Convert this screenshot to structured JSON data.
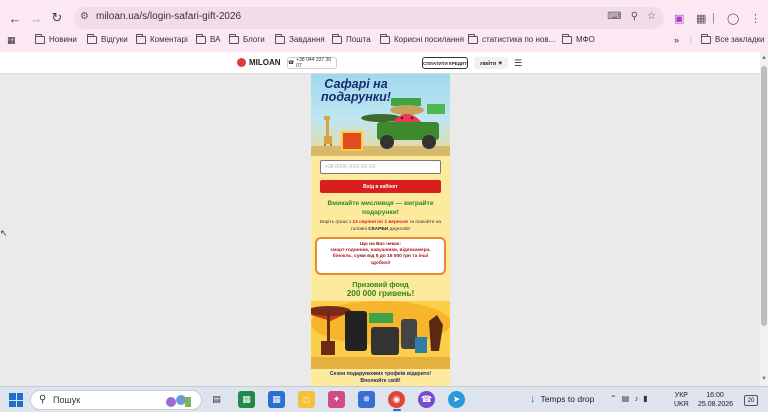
{
  "browser": {
    "url": "miloan.ua/s/login-safari-gift-2026",
    "bookmarks": [
      {
        "label": "Новини"
      },
      {
        "label": "Відгуки"
      },
      {
        "label": "Коментарі"
      },
      {
        "label": "ВА"
      },
      {
        "label": "Блоги"
      },
      {
        "label": "Завдання"
      },
      {
        "label": "Пошта"
      },
      {
        "label": "Корисні посилання"
      },
      {
        "label": "статистика по нов..."
      },
      {
        "label": "МФО"
      }
    ],
    "all_bookmarks": "Все закладки"
  },
  "site": {
    "logo": "MILOAN",
    "phone": "+38 044 337 30 07",
    "pay_credit": "СПЛАТИТИ КРЕДИТ",
    "login": "УВІЙТИ"
  },
  "promo": {
    "title": "Сафарі на подарунки!",
    "phone_placeholder": "+38 (0XX) XXX-XX-XX",
    "cabinet_button": "Вхід в кабінет",
    "headline": "Вмикайте мисливця — виграйте подарунки!",
    "rules_1": "Беріть гроші з ",
    "rules_dates": "13 серпня по 1 вересня",
    "rules_2": " та полюйте на головні ",
    "rules_bold": "СКАРБИ",
    "rules_3": " джунглів!",
    "prize_line_1": "Що на Вас чекає:",
    "prize_line_2": "смарт-годинник, навушники, відеокамера,",
    "prize_line_3": "бінокль, ",
    "prize_line_3_dark": "суми від 5 до 15 000 грн",
    "prize_line_3_end": " та інші",
    "prize_line_4": "здобичі!",
    "fund_label": "Призовий фонд",
    "fund_value": "200 000 гривень!",
    "season_1": "Сезон подарункових трофеїв відкрито!",
    "season_2": "Вполюйте свій!"
  },
  "taskbar": {
    "search": "Пошук",
    "weather": "Temps to drop",
    "lang_1": "УКР",
    "lang_2": "UKR",
    "time": "16:00",
    "date": "25.08.2026",
    "notifications": "20"
  }
}
